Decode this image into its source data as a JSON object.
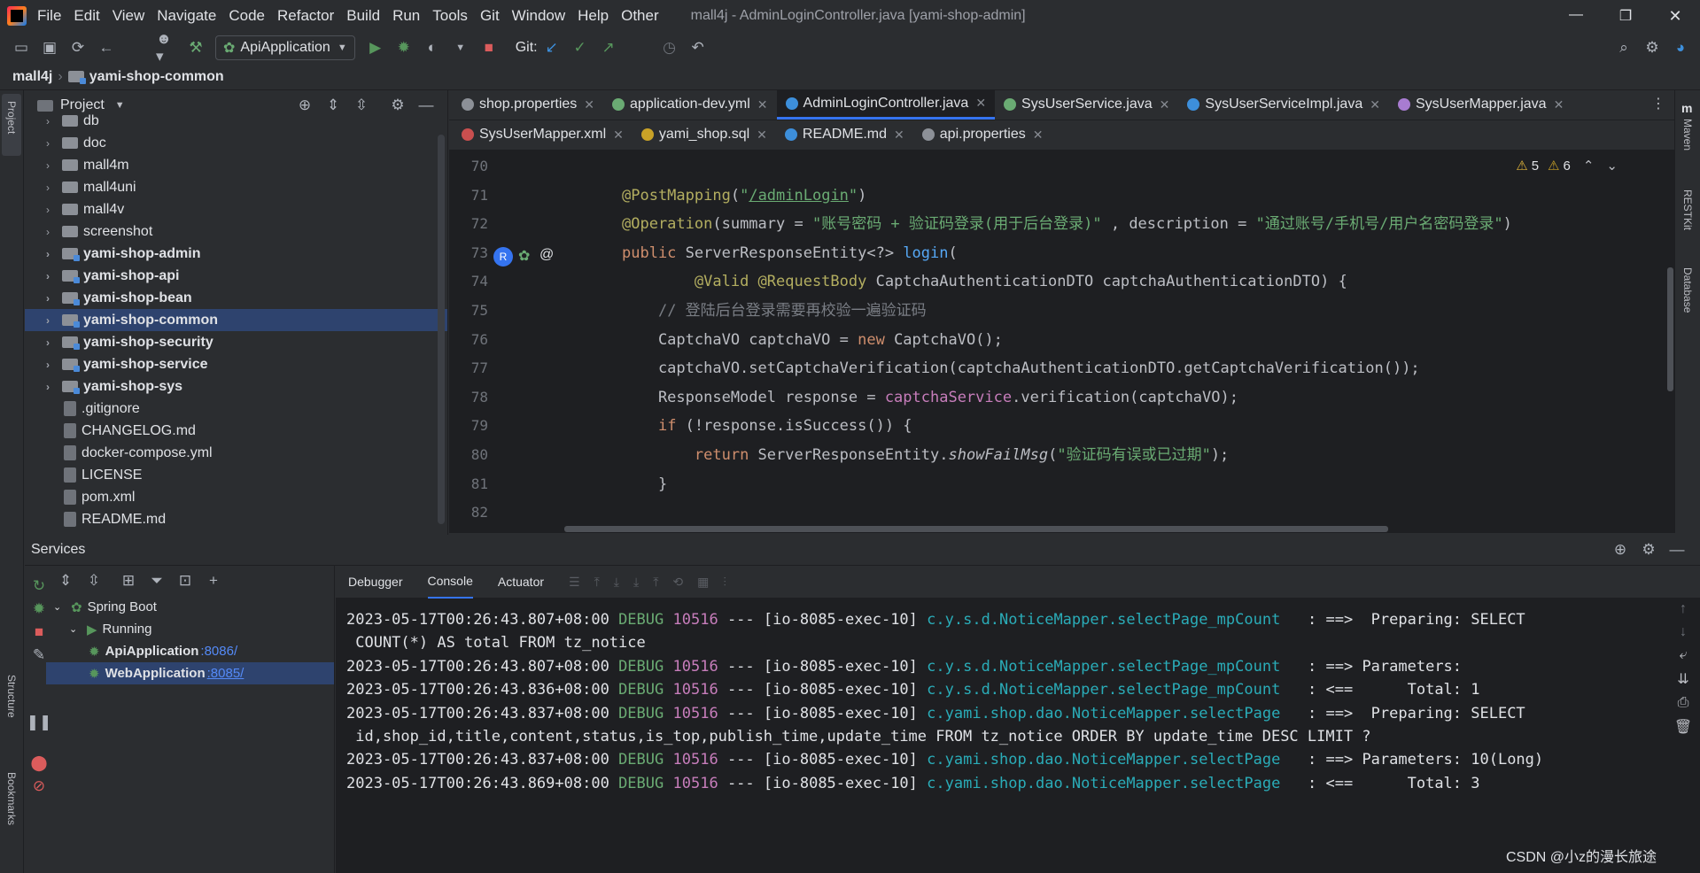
{
  "menubar": {
    "items": [
      "File",
      "Edit",
      "View",
      "Navigate",
      "Code",
      "Refactor",
      "Build",
      "Run",
      "Tools",
      "Git",
      "Window",
      "Help",
      "Other"
    ],
    "title": "mall4j - AdminLoginController.java [yami-shop-admin]"
  },
  "toolbar": {
    "run_config": "ApiApplication",
    "git_label": "Git:"
  },
  "breadcrumb": {
    "root": "mall4j",
    "module": "yami-shop-common"
  },
  "sidestrip": {
    "project": "Project",
    "structure": "Structure",
    "bookmarks": "Bookmarks",
    "maven": "Maven",
    "restkit": "RESTKit",
    "database": "Database"
  },
  "project": {
    "title": "Project",
    "items": [
      {
        "label": "db",
        "kind": "folder",
        "bold": false,
        "selected": false
      },
      {
        "label": "doc",
        "kind": "folder",
        "bold": false,
        "selected": false
      },
      {
        "label": "mall4m",
        "kind": "folder",
        "bold": false,
        "selected": false
      },
      {
        "label": "mall4uni",
        "kind": "folder",
        "bold": false,
        "selected": false
      },
      {
        "label": "mall4v",
        "kind": "folder",
        "bold": false,
        "selected": false
      },
      {
        "label": "screenshot",
        "kind": "folder",
        "bold": false,
        "selected": false
      },
      {
        "label": "yami-shop-admin",
        "kind": "module",
        "bold": true,
        "selected": false
      },
      {
        "label": "yami-shop-api",
        "kind": "module",
        "bold": true,
        "selected": false
      },
      {
        "label": "yami-shop-bean",
        "kind": "module",
        "bold": true,
        "selected": false
      },
      {
        "label": "yami-shop-common",
        "kind": "module",
        "bold": true,
        "selected": true
      },
      {
        "label": "yami-shop-security",
        "kind": "module",
        "bold": true,
        "selected": false
      },
      {
        "label": "yami-shop-service",
        "kind": "module",
        "bold": true,
        "selected": false
      },
      {
        "label": "yami-shop-sys",
        "kind": "module",
        "bold": true,
        "selected": false
      },
      {
        "label": ".gitignore",
        "kind": "file",
        "bold": false,
        "selected": false
      },
      {
        "label": "CHANGELOG.md",
        "kind": "file",
        "bold": false,
        "selected": false
      },
      {
        "label": "docker-compose.yml",
        "kind": "file",
        "bold": false,
        "selected": false
      },
      {
        "label": "LICENSE",
        "kind": "file",
        "bold": false,
        "selected": false
      },
      {
        "label": "pom.xml",
        "kind": "file",
        "bold": false,
        "selected": false
      },
      {
        "label": "README.md",
        "kind": "file",
        "bold": false,
        "selected": false
      }
    ]
  },
  "editor": {
    "tabs_row1": [
      {
        "label": "shop.properties",
        "color": "#8c9097",
        "active": false
      },
      {
        "label": "application-dev.yml",
        "color": "#6aab73",
        "active": false
      },
      {
        "label": "AdminLoginController.java",
        "color": "#3d8fdb",
        "active": true
      },
      {
        "label": "SysUserService.java",
        "color": "#6aab73",
        "active": false
      },
      {
        "label": "SysUserServiceImpl.java",
        "color": "#3d8fdb",
        "active": false
      },
      {
        "label": "SysUserMapper.java",
        "color": "#a87cd1",
        "active": false
      }
    ],
    "tabs_row2": [
      {
        "label": "SysUserMapper.xml",
        "color": "#c94f4f"
      },
      {
        "label": "yami_shop.sql",
        "color": "#c9a227"
      },
      {
        "label": "README.md",
        "color": "#3d8fdb"
      },
      {
        "label": "api.properties",
        "color": "#8c9097"
      }
    ],
    "warnings": "5",
    "weak_warnings": "6",
    "line_numbers": [
      "70",
      "71",
      "72",
      "73",
      "74",
      "75",
      "76",
      "77",
      "78",
      "79",
      "80",
      "81",
      "82"
    ],
    "code_lines": [
      {
        "indent": 0,
        "html": ""
      },
      {
        "indent": 0,
        "html": "<span style='color:#b3ae60'>@PostMapping</span>(<span style='color:#6aab73'>\"<u>/adminLogin</u>\"</span>)"
      },
      {
        "indent": 0,
        "html": "<span style='color:#b3ae60'>@Operation</span>(summary = <span style='color:#6aab73'>\"账号密码 + 验证码登录(用于后台登录)\"</span> , description = <span style='color:#6aab73'>\"通过账号/手机号/用户名密码登录\"</span>)"
      },
      {
        "indent": 0,
        "html": "<span style='color:#cf8e6d'>public</span> ServerResponseEntity&lt;?&gt; <span style='color:#56a8f5'>login</span>("
      },
      {
        "indent": 0,
        "html": "        <span style='color:#b3ae60'>@Valid @RequestBody</span> CaptchaAuthenticationDTO captchaAuthenticationDTO) {"
      },
      {
        "indent": 0,
        "html": "    <span style='color:#7a7e85'>// 登陆后台登录需要再校验一遍验证码</span>"
      },
      {
        "indent": 0,
        "html": "    CaptchaVO captchaVO = <span style='color:#cf8e6d'>new</span> CaptchaVO();"
      },
      {
        "indent": 0,
        "html": "    captchaVO.setCaptchaVerification(captchaAuthenticationDTO.getCaptchaVerification());"
      },
      {
        "indent": 0,
        "html": "    ResponseModel response = <span style='color:#c77dbb'>captchaService</span>.verification(captchaVO);"
      },
      {
        "indent": 0,
        "html": "    <span style='color:#cf8e6d'>if</span> (!response.isSuccess()) {"
      },
      {
        "indent": 0,
        "html": "        <span style='color:#cf8e6d'>return</span> ServerResponseEntity.<i>showFailMsg</i>(<span style='color:#6aab73'>\"验证码有误或已过期\"</span>);"
      },
      {
        "indent": 0,
        "html": "    }"
      },
      {
        "indent": 0,
        "html": ""
      }
    ]
  },
  "services": {
    "title": "Services",
    "tree": [
      {
        "label": "Spring Boot",
        "port": "",
        "level": 0,
        "selected": false
      },
      {
        "label": "Running",
        "port": "",
        "level": 1,
        "selected": false
      },
      {
        "label": "ApiApplication",
        "port": ":8086/",
        "level": 2,
        "selected": false
      },
      {
        "label": "WebApplication",
        "port": ":8085/",
        "level": 2,
        "selected": true
      }
    ],
    "console_tabs": [
      "Debugger",
      "Console",
      "Actuator"
    ],
    "logs": [
      {
        "ts": "2023-05-17T00:26:43.807+08:00",
        "level": "DEBUG",
        "pid": "10516",
        "sep": "---",
        "thread": "[io-8085-exec-10]",
        "logger": "c.y.s.d.NoticeMapper.selectPage_mpCount  ",
        "msg": " : ==>  Preparing: SELECT"
      },
      {
        "cont": " COUNT(*) AS total FROM tz_notice"
      },
      {
        "ts": "2023-05-17T00:26:43.807+08:00",
        "level": "DEBUG",
        "pid": "10516",
        "sep": "---",
        "thread": "[io-8085-exec-10]",
        "logger": "c.y.s.d.NoticeMapper.selectPage_mpCount  ",
        "msg": " : ==> Parameters:"
      },
      {
        "ts": "2023-05-17T00:26:43.836+08:00",
        "level": "DEBUG",
        "pid": "10516",
        "sep": "---",
        "thread": "[io-8085-exec-10]",
        "logger": "c.y.s.d.NoticeMapper.selectPage_mpCount  ",
        "msg": " : <==      Total: 1"
      },
      {
        "ts": "2023-05-17T00:26:43.837+08:00",
        "level": "DEBUG",
        "pid": "10516",
        "sep": "---",
        "thread": "[io-8085-exec-10]",
        "logger": "c.yami.shop.dao.NoticeMapper.selectPage  ",
        "msg": " : ==>  Preparing: SELECT"
      },
      {
        "cont": " id,shop_id,title,content,status,is_top,publish_time,update_time FROM tz_notice ORDER BY update_time DESC LIMIT ?"
      },
      {
        "ts": "2023-05-17T00:26:43.837+08:00",
        "level": "DEBUG",
        "pid": "10516",
        "sep": "---",
        "thread": "[io-8085-exec-10]",
        "logger": "c.yami.shop.dao.NoticeMapper.selectPage  ",
        "msg": " : ==> Parameters: 10(Long)"
      },
      {
        "ts": "2023-05-17T00:26:43.869+08:00",
        "level": "DEBUG",
        "pid": "10516",
        "sep": "---",
        "thread": "[io-8085-exec-10]",
        "logger": "c.yami.shop.dao.NoticeMapper.selectPage  ",
        "msg": " : <==      Total: 3"
      }
    ]
  },
  "watermark": "CSDN @小z的漫长旅途",
  "colors": {
    "accent": "#3574f0",
    "selection": "#2e436e",
    "debug": "#6aab73",
    "pid": "#c77dbb",
    "logger": "#2aacb8"
  }
}
